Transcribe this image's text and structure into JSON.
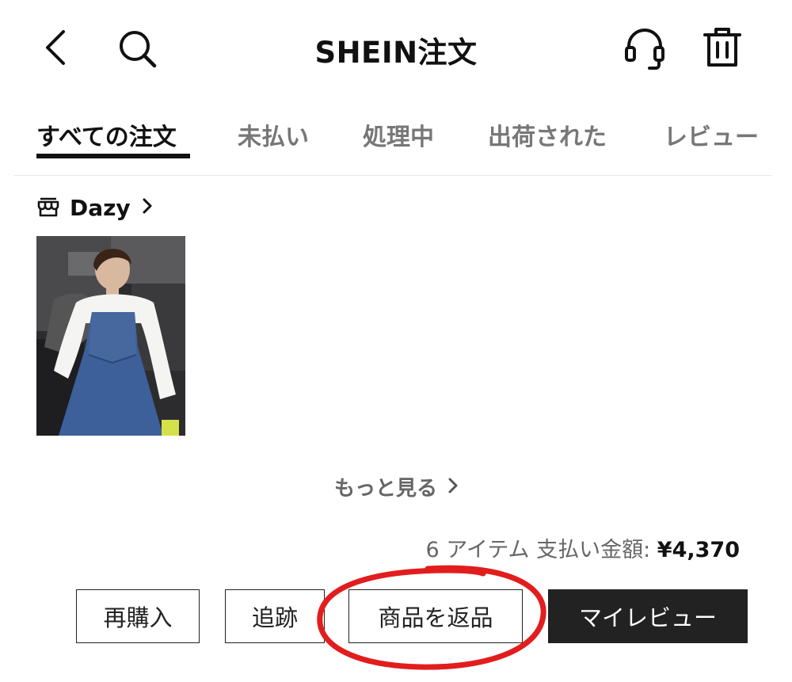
{
  "header": {
    "title": "SHEIN注文",
    "icons": [
      "back-icon",
      "search-icon",
      "headset-icon",
      "trash-icon"
    ]
  },
  "tabs": [
    {
      "label": "すべての注文",
      "active": true
    },
    {
      "label": "未払い",
      "active": false
    },
    {
      "label": "処理中",
      "active": false
    },
    {
      "label": "出荷された",
      "active": false
    },
    {
      "label": "レビュー",
      "active": false
    }
  ],
  "order": {
    "store_name": "Dazy",
    "store_icon": "store-icon",
    "more_label": "もっと見る",
    "summary_prefix": "6 アイテム 支払い金額: ",
    "total": "¥4,370"
  },
  "actions": {
    "repurchase": "再購入",
    "track": "追跡",
    "return": "商品を返品",
    "review": "マイレビュー"
  },
  "colors": {
    "accent": "#222222",
    "annotation": "#e21d1d",
    "tab_inactive": "#777777"
  }
}
